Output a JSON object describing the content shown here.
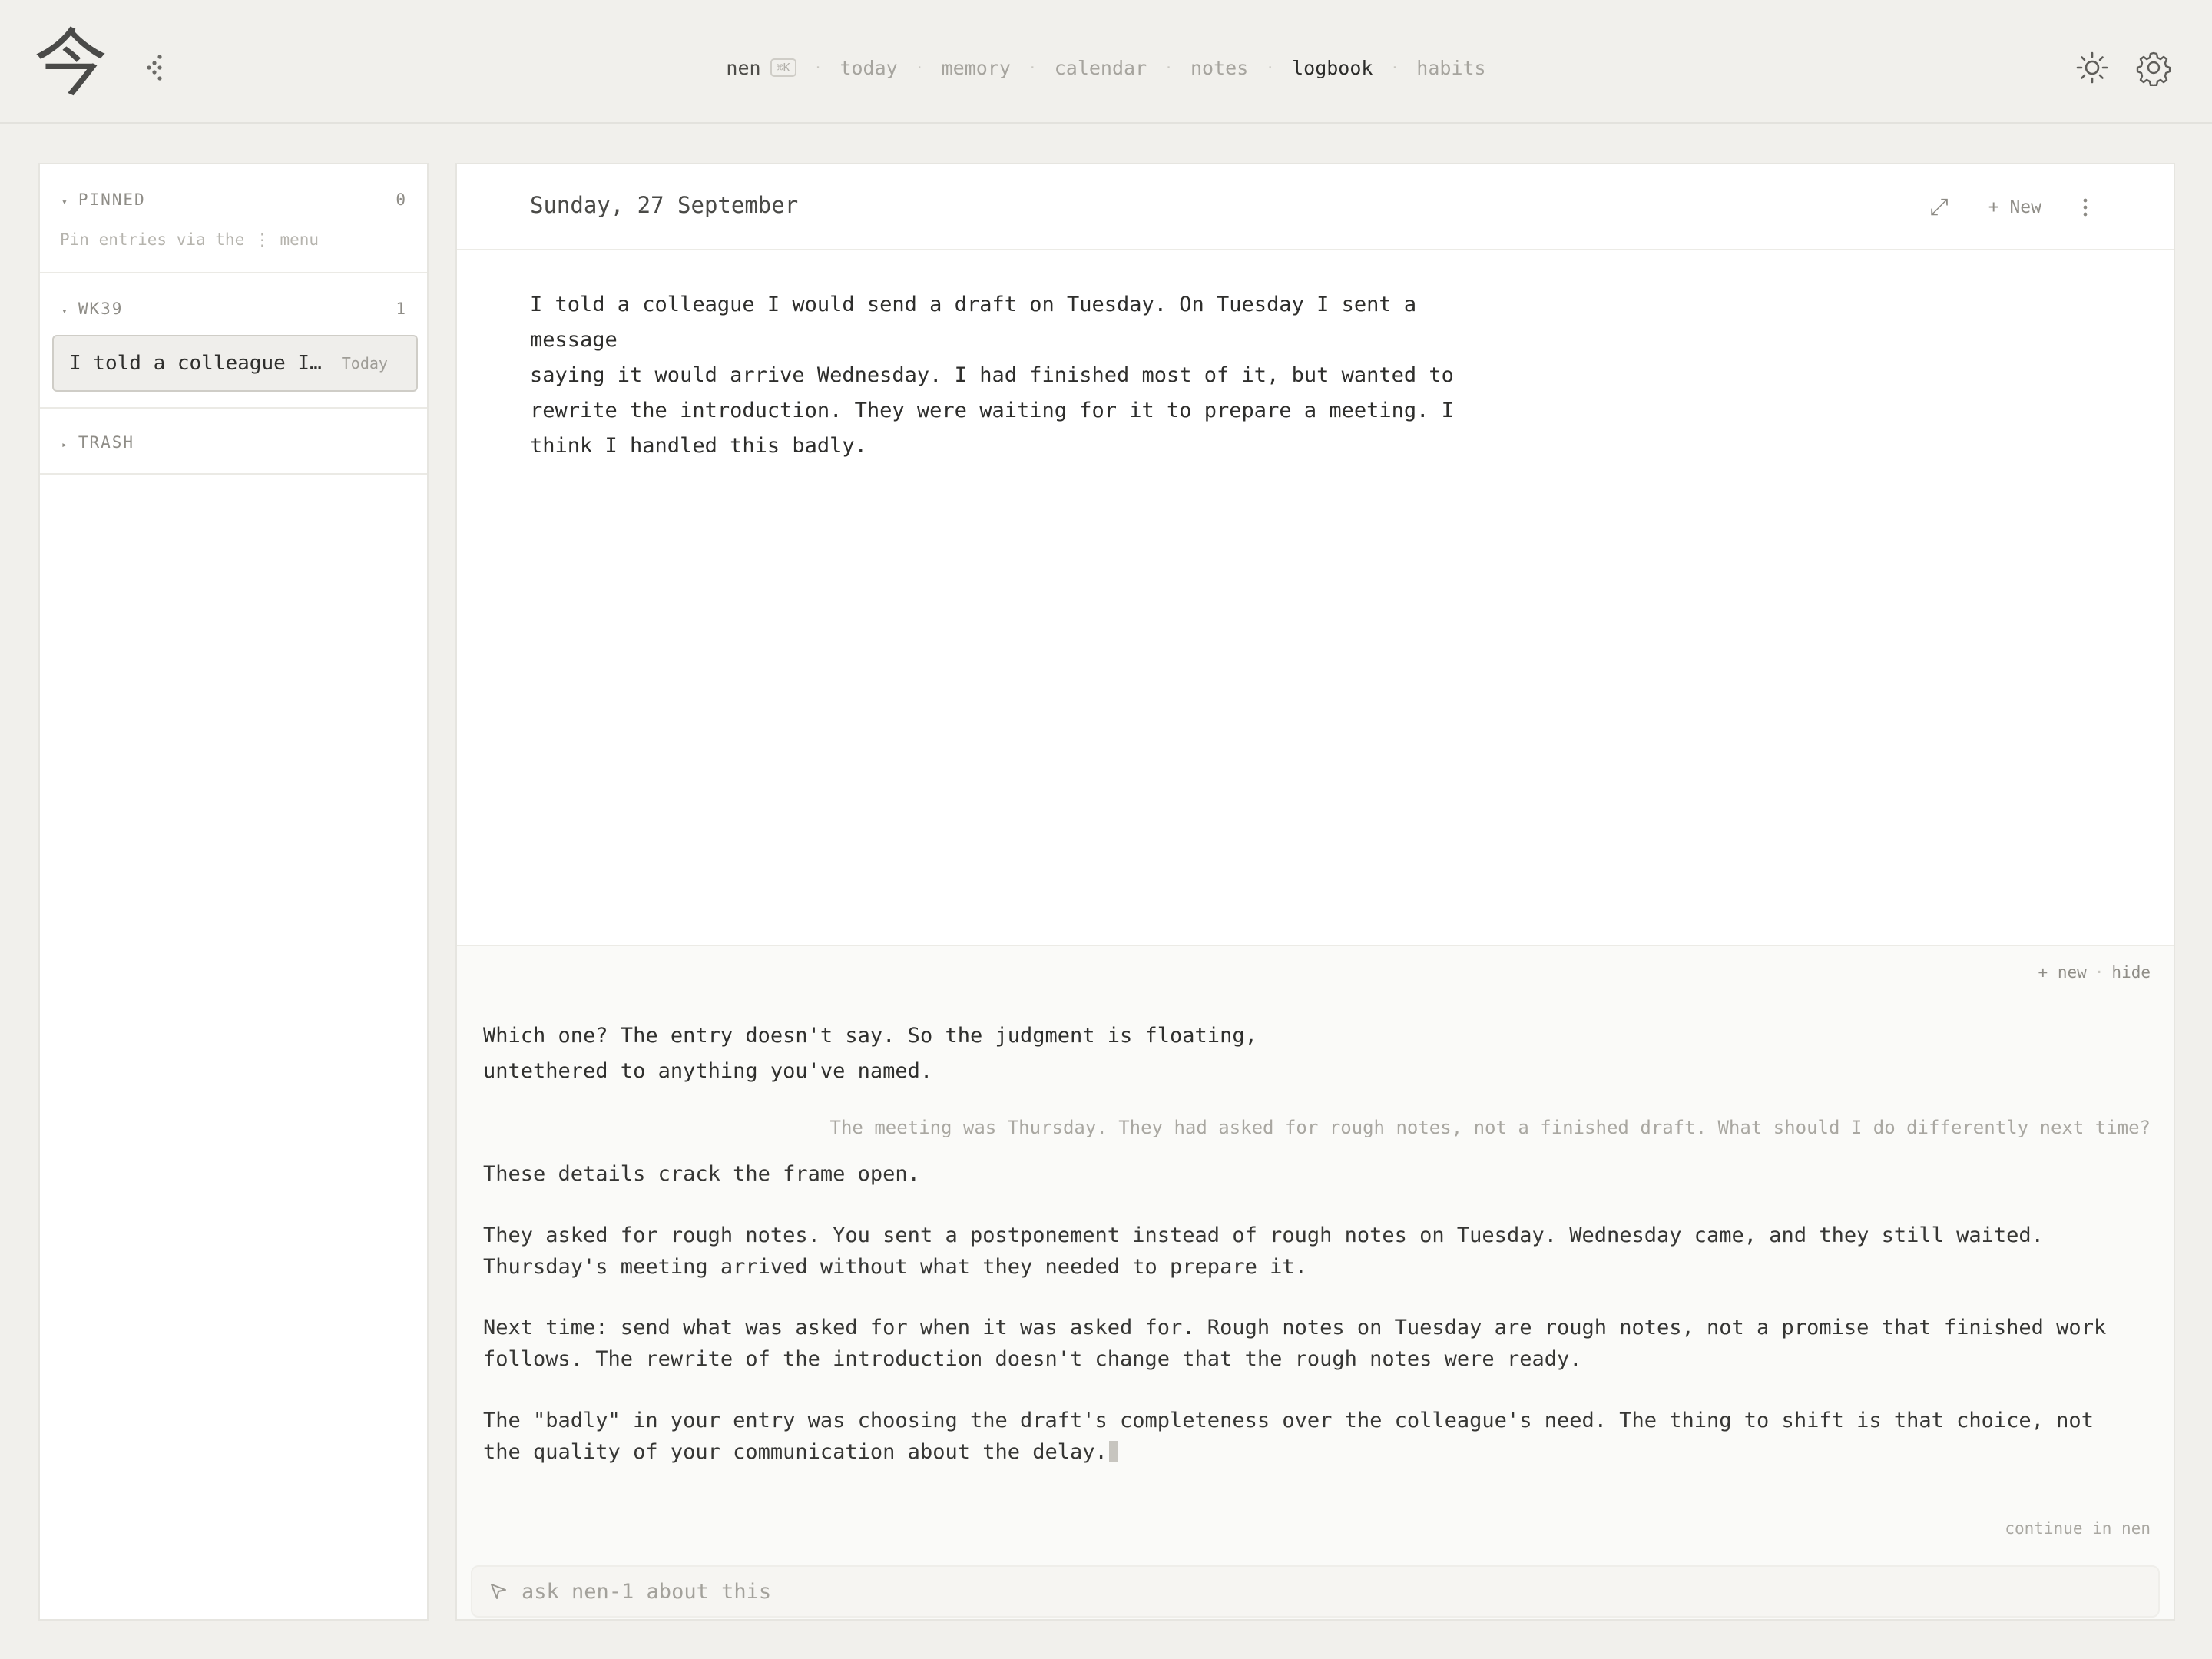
{
  "app": {
    "logo": "今"
  },
  "nav": {
    "brand": "nen",
    "shortcut": "⌘K",
    "items": [
      "today",
      "memory",
      "calendar",
      "notes",
      "logbook",
      "habits"
    ],
    "active": "logbook"
  },
  "sidebar": {
    "pinned": {
      "label": "PINNED",
      "count": "0",
      "hint": "Pin entries via the ⋮ menu"
    },
    "week": {
      "label": "WK39",
      "count": "1",
      "items": [
        {
          "title": "I told a colleague I…",
          "date": "Today"
        }
      ]
    },
    "trash": {
      "label": "TRASH"
    }
  },
  "entry": {
    "date": "Sunday, 27 September",
    "new_label": "+ New",
    "text": "I told a colleague I would send a draft on Tuesday. On Tuesday I sent a message\nsaying it would arrive Wednesday. I had finished most of it, but wanted to\nrewrite the introduction. They were waiting for it to prepare a meeting. I\nthink I handled this badly."
  },
  "chat": {
    "new_label": "+ new",
    "hide_label": "hide",
    "ai_first": "Which one? The entry doesn't say. So the judgment is floating,\nuntethered to anything you've named.",
    "user_msg": "The meeting was Thursday. They had asked for rough notes, not a finished draft. What should I do differently next time?",
    "ai_reply": [
      "These details crack the frame open.",
      "They asked for rough notes. You sent a postponement instead of rough notes on Tuesday. Wednesday came, and they still waited. Thursday's meeting arrived without what they needed to prepare it.",
      "Next time: send what was asked for when it was asked for. Rough notes on Tuesday are rough notes, not a promise that finished work follows. The rewrite of the introduction doesn't change that the rough notes were ready.",
      "The \"badly\" in your entry was choosing the draft's completeness over the colleague's need. The thing to shift is that choice, not the quality of your communication about the delay."
    ],
    "continue_label": "continue in nen",
    "input_placeholder": "ask nen-1 about this"
  }
}
